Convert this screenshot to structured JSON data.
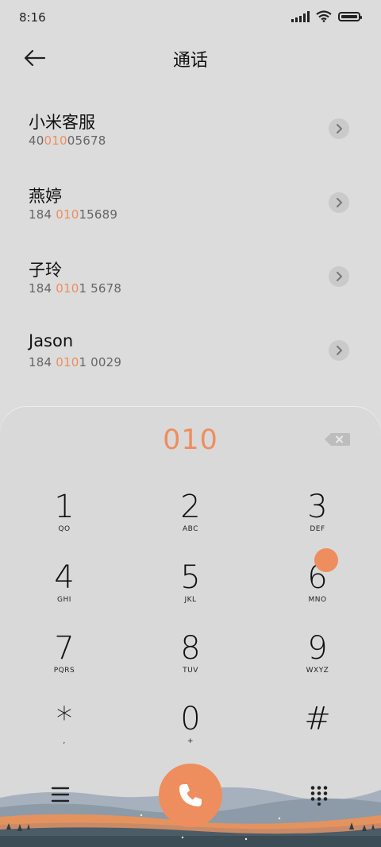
{
  "status": {
    "time": "8:16"
  },
  "header": {
    "title": "通话"
  },
  "contacts": [
    {
      "name": "小米客服",
      "num_pre": "40",
      "num_hl": "010",
      "num_post": "05678"
    },
    {
      "name": "燕婷",
      "num_pre": "184 ",
      "num_hl": "010",
      "num_post": "15689"
    },
    {
      "name": "子玲",
      "num_pre": "184 ",
      "num_hl": "010",
      "num_post": "1 5678"
    },
    {
      "name": "Jason",
      "num_pre": "184 ",
      "num_hl": "010",
      "num_post": "1 0029"
    }
  ],
  "dialer": {
    "number": "010",
    "keys": [
      {
        "digit": "1",
        "letters": "QO"
      },
      {
        "digit": "2",
        "letters": "ABC"
      },
      {
        "digit": "3",
        "letters": "DEF"
      },
      {
        "digit": "4",
        "letters": "GHI"
      },
      {
        "digit": "5",
        "letters": "JKL"
      },
      {
        "digit": "6",
        "letters": "MNO"
      },
      {
        "digit": "7",
        "letters": "PQRS"
      },
      {
        "digit": "8",
        "letters": "TUV"
      },
      {
        "digit": "9",
        "letters": "WXYZ"
      },
      {
        "digit": "*",
        "letters": ","
      },
      {
        "digit": "0",
        "letters": "+"
      },
      {
        "digit": "#",
        "letters": ""
      }
    ]
  },
  "colors": {
    "accent": "#ee8e5e",
    "background": "#dcdcdc"
  }
}
